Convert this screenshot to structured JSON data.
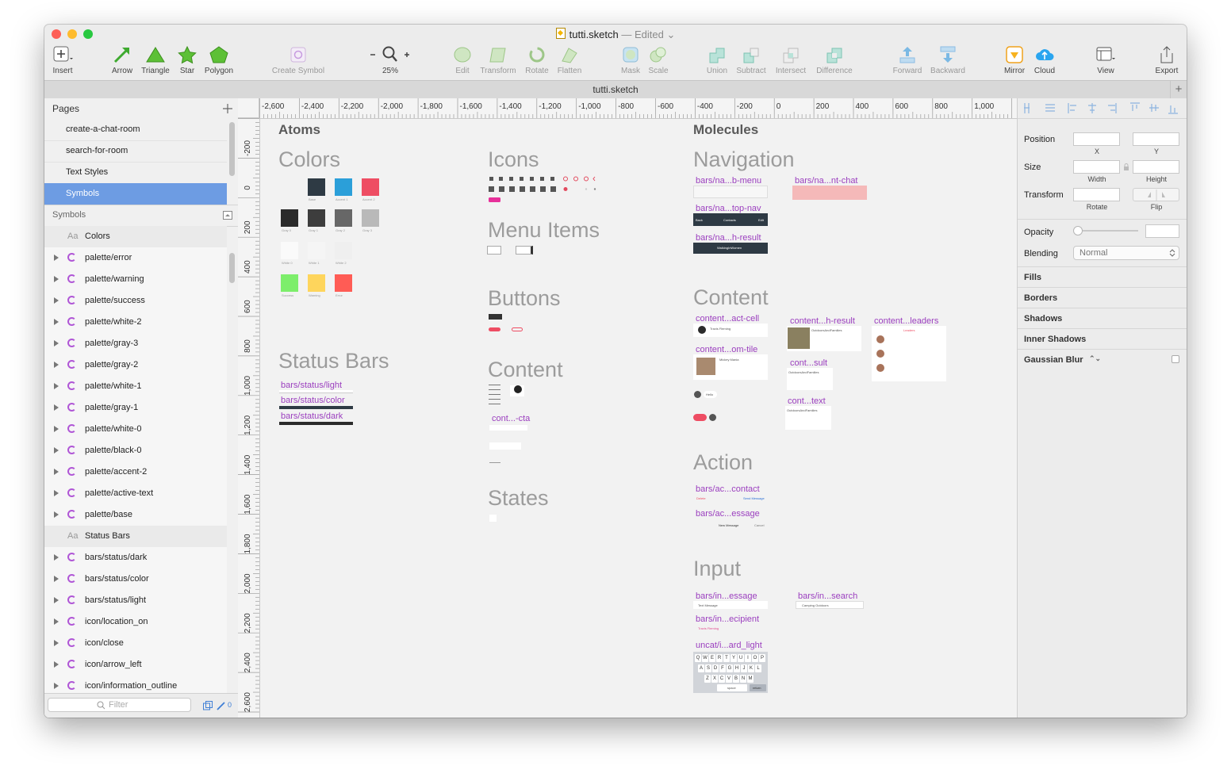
{
  "window": {
    "filename": "tutti.sketch",
    "edited": "— Edited",
    "tab_title": "tutti.sketch",
    "traffic": {
      "close": "#fd5f57",
      "minimize": "#febb2e",
      "zoom": "#28c840"
    }
  },
  "toolbar": {
    "insert": "Insert",
    "arrow": "Arrow",
    "triangle": "Triangle",
    "star": "Star",
    "polygon": "Polygon",
    "create_symbol": "Create Symbol",
    "zoom": "25%",
    "edit": "Edit",
    "transform": "Transform",
    "rotate": "Rotate",
    "flatten": "Flatten",
    "mask": "Mask",
    "scale": "Scale",
    "union": "Union",
    "subtract": "Subtract",
    "intersect": "Intersect",
    "difference": "Difference",
    "forward": "Forward",
    "backward": "Backward",
    "mirror": "Mirror",
    "cloud": "Cloud",
    "view": "View",
    "export": "Export"
  },
  "pages": {
    "header": "Pages",
    "items": [
      {
        "label": "create-a-chat-room"
      },
      {
        "label": "search-for-room"
      },
      {
        "label": "Text Styles"
      },
      {
        "label": "Symbols",
        "selected": true
      }
    ]
  },
  "layers": {
    "header": "Symbols",
    "items": [
      {
        "label": "Colors",
        "type": "group"
      },
      {
        "label": "palette/error",
        "type": "symbol"
      },
      {
        "label": "palette/warning",
        "type": "symbol"
      },
      {
        "label": "palette/success",
        "type": "symbol"
      },
      {
        "label": "palette/white-2",
        "type": "symbol"
      },
      {
        "label": "palette/gray-3",
        "type": "symbol"
      },
      {
        "label": "palette/gray-2",
        "type": "symbol"
      },
      {
        "label": "palette/white-1",
        "type": "symbol"
      },
      {
        "label": "palette/gray-1",
        "type": "symbol"
      },
      {
        "label": "palette/white-0",
        "type": "symbol"
      },
      {
        "label": "palette/black-0",
        "type": "symbol"
      },
      {
        "label": "palette/accent-2",
        "type": "symbol"
      },
      {
        "label": "palette/active-text",
        "type": "symbol"
      },
      {
        "label": "palette/base",
        "type": "symbol"
      },
      {
        "label": "Status Bars",
        "type": "group"
      },
      {
        "label": "bars/status/dark",
        "type": "symbol"
      },
      {
        "label": "bars/status/color",
        "type": "symbol"
      },
      {
        "label": "bars/status/light",
        "type": "symbol"
      },
      {
        "label": "icon/location_on",
        "type": "symbol"
      },
      {
        "label": "icon/close",
        "type": "symbol"
      },
      {
        "label": "icon/arrow_left",
        "type": "symbol"
      },
      {
        "label": "icon/information_outline",
        "type": "symbol"
      }
    ],
    "filter_placeholder": "Filter",
    "filter_count": "0"
  },
  "ruler": {
    "top": [
      "-2,600",
      "-2,400",
      "-2,200",
      "-2,000",
      "-1,800",
      "-1,600",
      "-1,400",
      "-1,200",
      "-1,000",
      "-800",
      "-600",
      "-400",
      "-200",
      "0",
      "200",
      "400",
      "600",
      "800",
      "1,000"
    ],
    "left": [
      "-200",
      "0",
      "200",
      "400",
      "600",
      "800",
      "1,000",
      "1,200",
      "1,400",
      "1,600",
      "1,800",
      "2,000",
      "2,200",
      "2,400",
      "2,600"
    ]
  },
  "inspector": {
    "position": "Position",
    "x": "X",
    "y": "Y",
    "size": "Size",
    "width": "Width",
    "height": "Height",
    "transform": "Transform",
    "rotate": "Rotate",
    "flip": "Flip",
    "opacity": "Opacity",
    "blending": "Blending",
    "blending_value": "Normal",
    "sections": [
      "Fills",
      "Borders",
      "Shadows",
      "Inner Shadows",
      "Gaussian Blur"
    ]
  },
  "canvas": {
    "atoms": "Atoms",
    "molecules": "Molecules",
    "titles": {
      "colors": "Colors",
      "icons": "Icons",
      "menu_items": "Menu Items",
      "buttons": "Buttons",
      "content": "Content",
      "states": "States",
      "status_bars": "Status Bars",
      "navigation": "Navigation",
      "mol_content": "Content",
      "action": "Action",
      "input": "Input"
    },
    "swatch_labels": {
      "row1": [
        "Base",
        "Accent 1",
        "Accent 2"
      ],
      "row2": [
        "Gray 0",
        "Gray 1",
        "Gray 2",
        "Gray 3"
      ],
      "row3": [
        "White 0",
        "White 1",
        "White 2"
      ],
      "row4": [
        "Success",
        "Warning",
        "Error"
      ]
    },
    "swatch_colors": {
      "row1": [
        "#2e3a44",
        "#2b9fd9",
        "#ee4d63"
      ],
      "row2": [
        "#2b2b2b",
        "#3d3d3d",
        "#676767",
        "#b9b9b9"
      ],
      "row3": [
        "#fafafa",
        "#f5f5f5",
        "#efefef"
      ],
      "row4": [
        "#7dee6b",
        "#fed55c",
        "#ff5c55"
      ]
    },
    "links": {
      "status_light": "bars/status/light",
      "status_color": "bars/status/color",
      "status_dark": "bars/status/dark",
      "cont_cta": "cont...-cta",
      "nav_menu": "bars/na...b-menu",
      "nav_chat": "bars/na...nt-chat",
      "nav_top": "bars/na...top-nav",
      "nav_result": "bars/na...h-result",
      "content_act": "content...act-cell",
      "content_tile": "content...om-tile",
      "content_hresult": "content...h-result",
      "content_leaders": "content...leaders",
      "cont_sult": "cont...sult",
      "cont_text": "cont...text",
      "action_contact": "bars/ac...contact",
      "action_message": "bars/ac...essage",
      "input_message": "bars/in...essage",
      "input_search": "bars/in...search",
      "input_recipient": "bars/in...ecipient",
      "keyboard": "uncat/i...ard_light"
    },
    "mini": {
      "contacts": "Contacts",
      "back": "Back",
      "edit": "Edit",
      "search_result": "WalkingInWomen",
      "tutti": "tutti",
      "hello": "Hello",
      "delete": "Delete",
      "send_message": "Send Message",
      "new_message": "New Message",
      "cancel": "Cancel",
      "text_message": "Text Message",
      "camping": "Camping Outdoors",
      "outdoors": "OutdoorsAndFamilies",
      "leaders": "Leaders",
      "travis": "Travis Fleming",
      "mikey": "Mickey Mania",
      "space": "space",
      "return": "return",
      "keys_row1": [
        "Q",
        "W",
        "E",
        "R",
        "T",
        "Y",
        "U",
        "I",
        "O",
        "P"
      ],
      "keys_row2": [
        "A",
        "S",
        "D",
        "F",
        "G",
        "H",
        "J",
        "K",
        "L"
      ],
      "keys_row3": [
        "Z",
        "X",
        "C",
        "V",
        "B",
        "N",
        "M"
      ]
    }
  }
}
